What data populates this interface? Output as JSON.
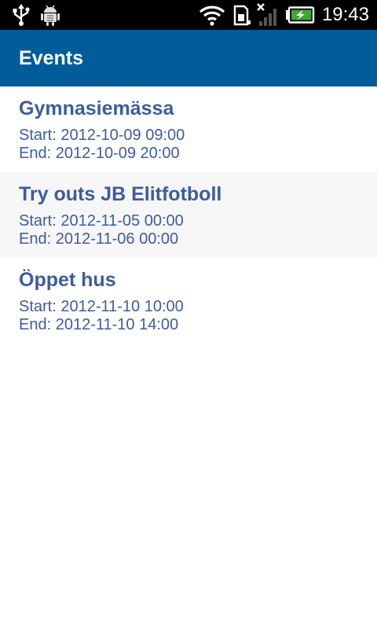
{
  "status_bar": {
    "time": "19:43",
    "icons": [
      "usb-icon",
      "android-debug-icon",
      "wifi-icon",
      "sd-card-icon",
      "signal-icon",
      "battery-charging-icon"
    ]
  },
  "colors": {
    "action_bar": "#005c9a",
    "event_text": "#3e5c9c",
    "alt_row": "#f6f6f6"
  },
  "header": {
    "title": "Events"
  },
  "events": [
    {
      "title": "Gymnasiemässa",
      "start": "Start: 2012-10-09 09:00",
      "end": "End: 2012-10-09 20:00"
    },
    {
      "title": "Try outs JB Elitfotboll",
      "start": "Start: 2012-11-05 00:00",
      "end": "End: 2012-11-06 00:00"
    },
    {
      "title": "Öppet hus",
      "start": "Start: 2012-11-10 10:00",
      "end": "End: 2012-11-10 14:00"
    }
  ]
}
